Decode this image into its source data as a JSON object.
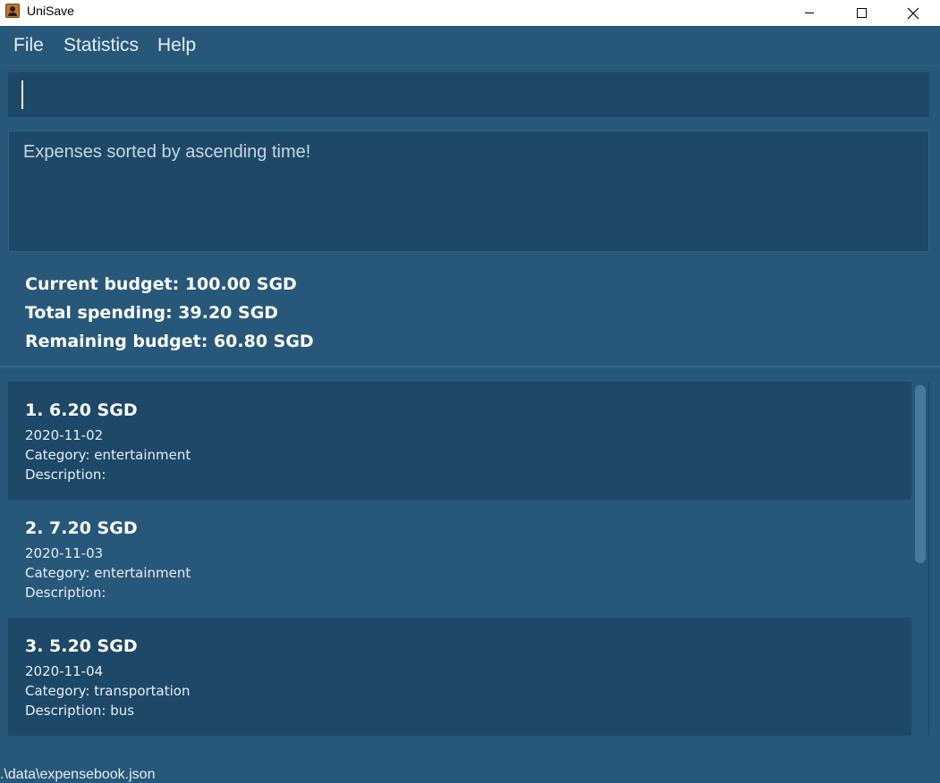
{
  "window": {
    "title": "UniSave",
    "minimize_icon": "minimize-icon",
    "maximize_icon": "maximize-icon",
    "close_icon": "close-icon"
  },
  "menu": {
    "items": [
      "File",
      "Statistics",
      "Help"
    ]
  },
  "command": {
    "value": "",
    "placeholder": ""
  },
  "result": {
    "message": "Expenses sorted by ascending time!"
  },
  "budget": {
    "current": "Current budget: 100.00 SGD",
    "spending": "Total spending: 39.20 SGD",
    "remaining": "Remaining budget: 60.80 SGD"
  },
  "expenses": [
    {
      "title": "1.  6.20 SGD",
      "date": "2020-11-02",
      "category": "Category: entertainment",
      "description": "Description:"
    },
    {
      "title": "2.  7.20 SGD",
      "date": "2020-11-03",
      "category": "Category: entertainment",
      "description": "Description:"
    },
    {
      "title": "3.  5.20 SGD",
      "date": "2020-11-04",
      "category": "Category: transportation",
      "description": "Description: bus"
    }
  ],
  "status": {
    "path": ".\\data\\expensebook.json"
  },
  "colors": {
    "background": "#27587a",
    "panel": "#1d4868",
    "text": "#ffffff"
  }
}
